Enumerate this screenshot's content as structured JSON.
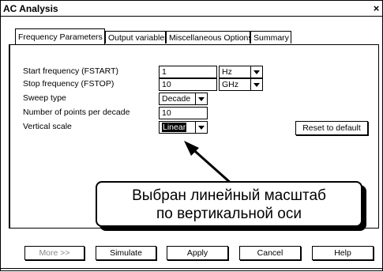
{
  "window": {
    "title": "AC Analysis",
    "close_glyph": "×"
  },
  "tabs": [
    {
      "label": "Frequency Parameters",
      "active": true
    },
    {
      "label": "Output variables",
      "active": false
    },
    {
      "label": "Miscellaneous Options",
      "active": false
    },
    {
      "label": "Summary",
      "active": false
    }
  ],
  "form": {
    "start_label": "Start frequency (FSTART)",
    "start_value": "1",
    "start_unit": "Hz",
    "stop_label": "Stop frequency (FSTOP)",
    "stop_value": "10",
    "stop_unit": "GHz",
    "sweep_label": "Sweep type",
    "sweep_value": "Decade",
    "points_label": "Number of points per decade",
    "points_value": "10",
    "vscale_label": "Vertical scale",
    "vscale_value": "Linear"
  },
  "reset_label": "Reset to default",
  "callout": {
    "line1": "Выбран линейный масштаб",
    "line2": "по вертикальной оси"
  },
  "buttons": {
    "more": "More >>",
    "simulate": "Simulate",
    "apply": "Apply",
    "cancel": "Cancel",
    "help": "Help"
  }
}
